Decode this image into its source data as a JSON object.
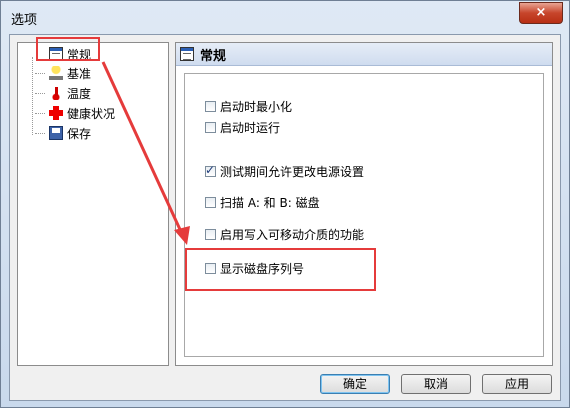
{
  "window": {
    "title": "选项",
    "close_glyph": "×"
  },
  "tree": {
    "items": [
      {
        "label": "常规",
        "icon": "general-icon"
      },
      {
        "label": "基准",
        "icon": "benchmark-icon"
      },
      {
        "label": "温度",
        "icon": "thermometer-icon"
      },
      {
        "label": "健康状况",
        "icon": "health-cross-icon"
      },
      {
        "label": "保存",
        "icon": "floppy-disk-icon"
      }
    ]
  },
  "panel": {
    "title": "常规",
    "options": [
      {
        "label": "启动时最小化",
        "checked": false
      },
      {
        "label": "启动时运行",
        "checked": false
      },
      {
        "label": "测试期间允许更改电源设置",
        "checked": true
      },
      {
        "label": "扫描 A: 和 B: 磁盘",
        "checked": false
      },
      {
        "label": "启用写入可移动介质的功能",
        "checked": false
      },
      {
        "label": "显示磁盘序列号",
        "checked": false
      }
    ]
  },
  "buttons": {
    "ok": "确定",
    "cancel": "取消",
    "apply": "应用"
  },
  "annotation": {
    "color": "#e53b3b"
  }
}
